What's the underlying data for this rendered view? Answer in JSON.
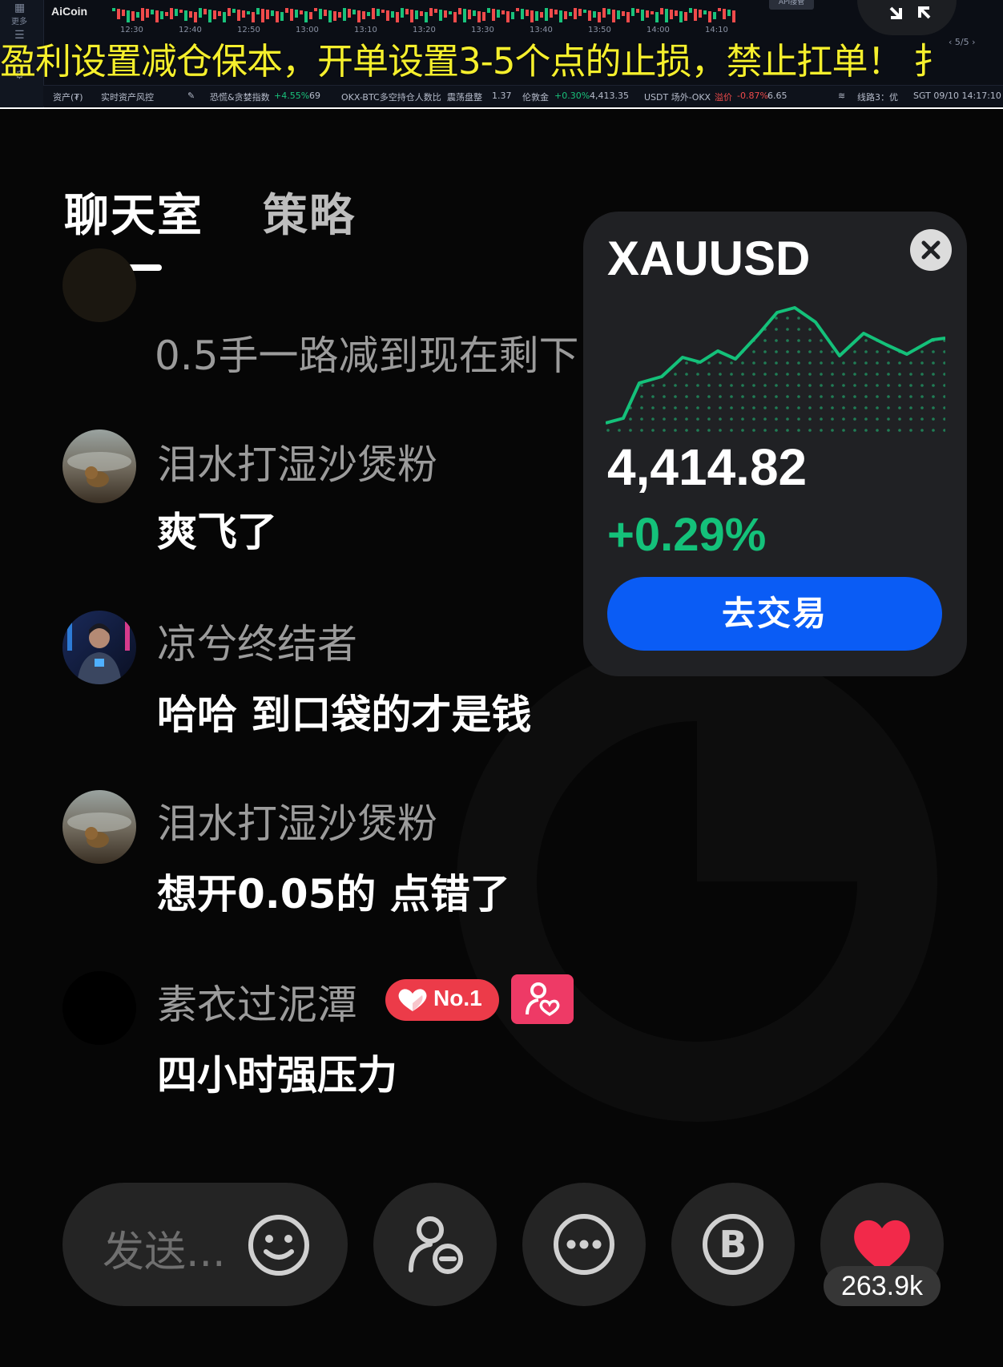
{
  "top_banner": {
    "app_logo": "AiCoin",
    "left_menu_label": "更多",
    "time_ticks": [
      "12:30",
      "12:40",
      "12:50",
      "13:00",
      "13:10",
      "13:20",
      "13:30",
      "13:40",
      "13:50",
      "14:00",
      "14:10"
    ],
    "marquee_text": "盈利设置减仓保本，开单设置3-5个点的止损，禁止扛单！ 扌",
    "pager": "5/5",
    "api_button": "API接管",
    "status_items": {
      "assets": "资产(₮)",
      "risk": "实时资产风控",
      "fear_greed_label": "恐慌&贪婪指数",
      "fear_greed_change": "+4.55%",
      "fear_greed_value": "69",
      "okx_label": "OKX-BTC多空持仓人数比",
      "okx_state": "震荡盘整",
      "okx_value": "1.37",
      "gold_label": "伦敦金",
      "gold_change": "+0.30%",
      "gold_value": "4,413.35",
      "usdt_label": "USDT 场外-OKX",
      "usdt_state": "溢价",
      "usdt_change": "-0.87%",
      "usdt_value": "6.65",
      "line": "线路3：优",
      "clock": "SGT 09/10 14:17:10"
    }
  },
  "tabs": [
    {
      "label": "聊天室",
      "active": true
    },
    {
      "label": "策略",
      "active": false
    }
  ],
  "chat": {
    "partial_message": "0.5手一路减到现在剩下",
    "messages": [
      {
        "user": "泪水打湿沙煲粉",
        "text": "爽飞了"
      },
      {
        "user": "凉兮终结者",
        "text": "哈哈 到口袋的才是钱"
      },
      {
        "user": "泪水打湿沙煲粉",
        "text": "想开0.05的 点错了"
      },
      {
        "user": "素衣过泥潭",
        "text": "四小时强压力",
        "badge": "No.1"
      }
    ]
  },
  "ticker_card": {
    "symbol": "XAUUSD",
    "price": "4,414.82",
    "change": "+0.29%",
    "trade_button": "去交易",
    "accent_color": "#14c17a",
    "button_color": "#0a5cf5"
  },
  "bottom_bar": {
    "send_placeholder": "发送...",
    "likes": "263.9k",
    "icons": [
      "emoji-icon",
      "user-minus-icon",
      "more-icon",
      "b-coin-icon",
      "heart-icon"
    ]
  }
}
